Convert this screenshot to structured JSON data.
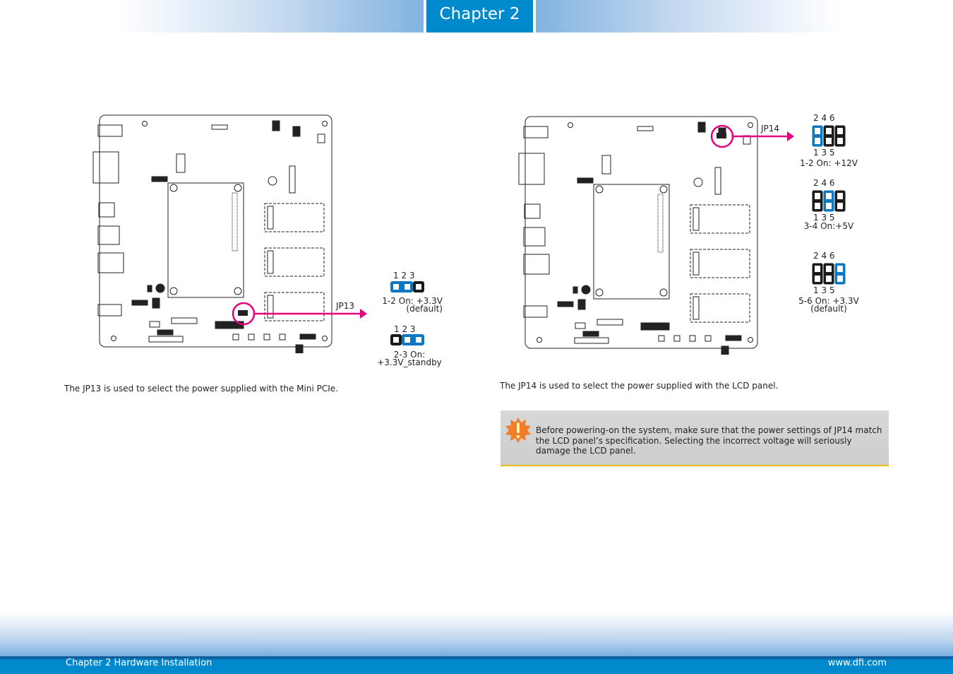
{
  "header": {
    "chapter": "Chapter 2"
  },
  "left": {
    "connector_label": "JP13",
    "pins_label": "1  2  3",
    "settings": [
      {
        "pins": "1  2  3",
        "line1": "1-2 On:  +3.3V",
        "line2": "(default)",
        "on": [
          1,
          2
        ]
      },
      {
        "pins": "1  2  3",
        "line1": "2-3 On:",
        "line2": "+3.3V_standby",
        "on": [
          2,
          3
        ]
      }
    ],
    "caption": "The JP13 is used to select the power supplied with the Mini PCIe."
  },
  "right": {
    "connector_label": "JP14",
    "settings": [
      {
        "top": "2  4  6",
        "bottom": "1  3  5",
        "line1": "1-2 On:  +12V",
        "line2": "",
        "on_column": 1
      },
      {
        "top": "2  4  6",
        "bottom": "1  3  5",
        "line1": "3-4 On:+5V",
        "line2": "",
        "on_column": 2
      },
      {
        "top": "2  4  6",
        "bottom": "1  3  5",
        "line1": "5-6 On:  +3.3V",
        "line2": "(default)",
        "on_column": 3
      }
    ],
    "caption": "The JP14 is used to select the power supplied with the LCD panel.",
    "note": "Before powering-on the system, make sure that the power settings of JP14 match the LCD panel’s specification. Selecting the incorrect voltage will seriously damage the LCD panel.",
    "note_icon": "warning-icon"
  },
  "footer": {
    "left": "Chapter 2 Hardware Installation",
    "right": "www.dfi.com"
  },
  "colors": {
    "accent": "#0089cc",
    "jumper_on": "#0a78c2",
    "jumper_off": "#1a1a1a",
    "highlight": "#e6007e",
    "note_border": "#f0b91e"
  }
}
